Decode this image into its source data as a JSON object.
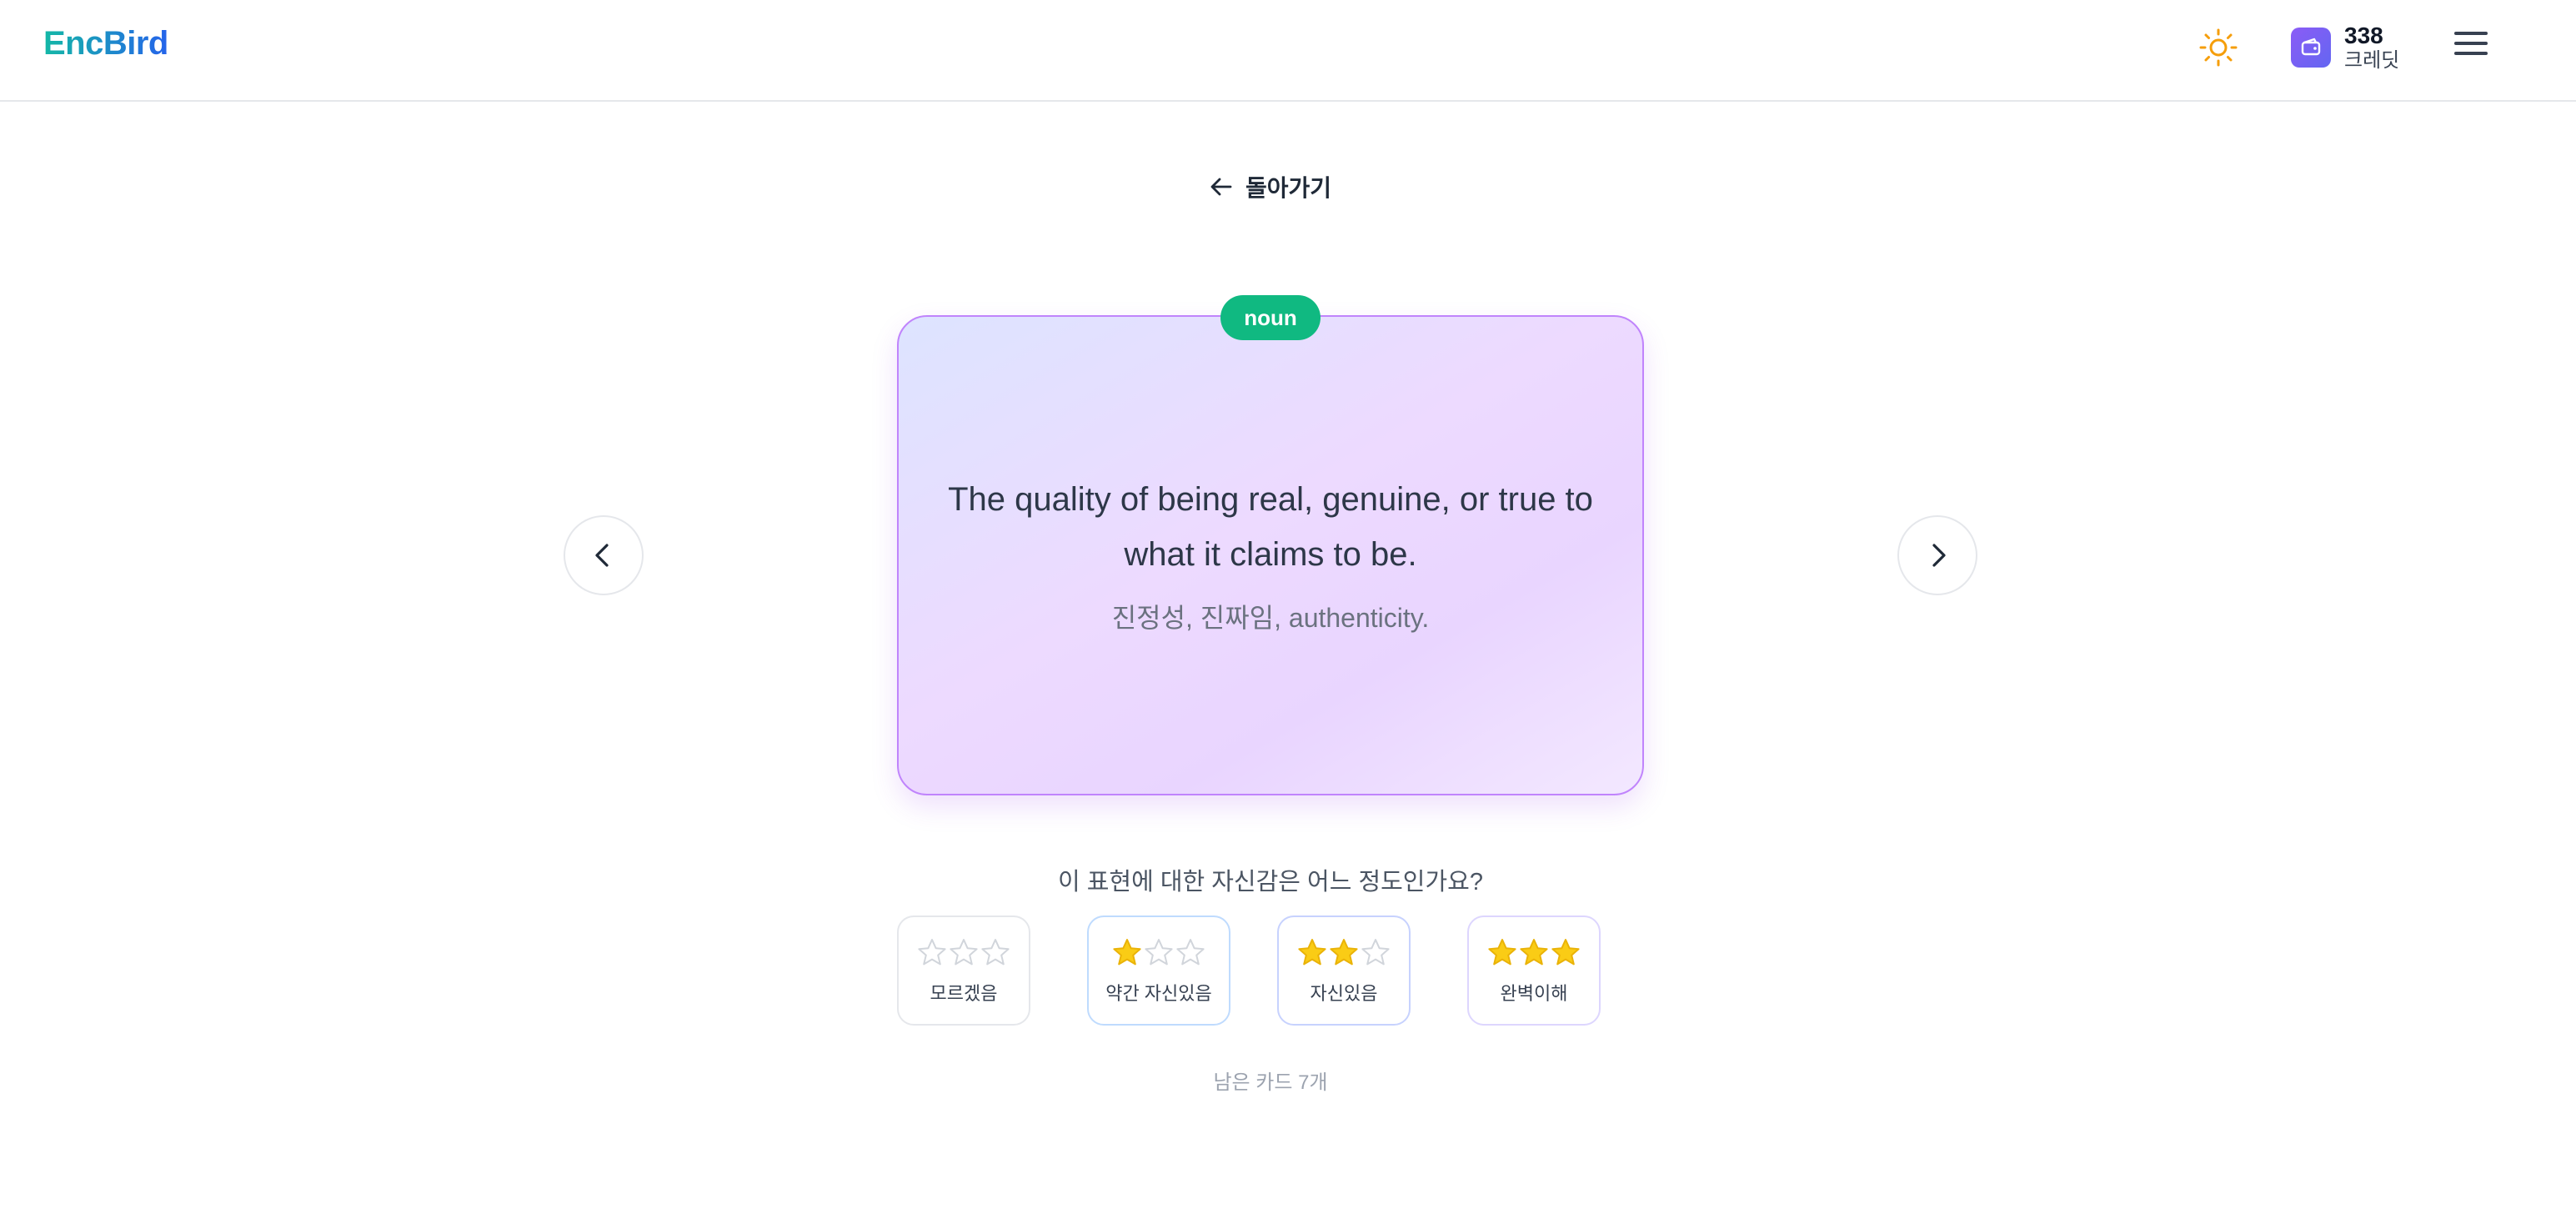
{
  "header": {
    "logo": "EncBird",
    "credits": {
      "amount": "338",
      "label": "크레딧"
    }
  },
  "back": {
    "label": "돌아가기"
  },
  "card": {
    "part_of_speech": "noun",
    "definition": "The quality of being real, genuine, or true to what it claims to be.",
    "translation": "진정성, 진짜임, authenticity."
  },
  "confidence": {
    "question": "이 표현에 대한 자신감은 어느 정도인가요?",
    "options": [
      {
        "label": "모르겠음",
        "stars": 0
      },
      {
        "label": "약간 자신있음",
        "stars": 1
      },
      {
        "label": "자신있음",
        "stars": 2
      },
      {
        "label": "완벽이해",
        "stars": 3
      }
    ]
  },
  "remaining": "남은 카드 7개",
  "colors": {
    "accent_teal": "#14b8a6",
    "badge_green": "#10b981",
    "star_gold": "#facc15",
    "card_border": "#c084fc"
  }
}
